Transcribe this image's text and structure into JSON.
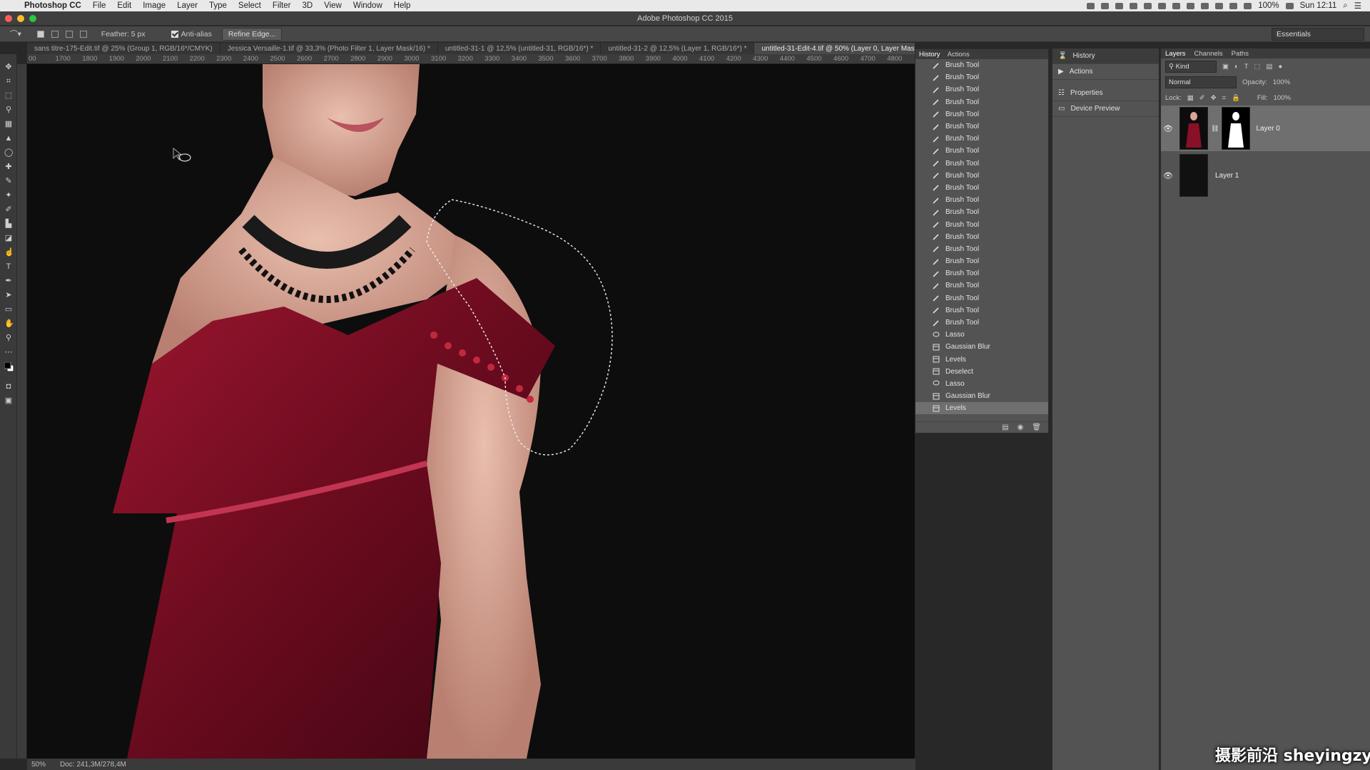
{
  "menubar": {
    "app_name": "Photoshop CC",
    "items": [
      "File",
      "Edit",
      "Image",
      "Layer",
      "Type",
      "Select",
      "Filter",
      "3D",
      "View",
      "Window",
      "Help"
    ],
    "battery": "100%",
    "clock": "Sun 12:11"
  },
  "window_title": "Adobe Photoshop CC 2015",
  "options_bar": {
    "feather_label": "Feather: 5 px",
    "antialias_label": "Anti-alias",
    "refine_edge_label": "Refine Edge...",
    "workspace": "Essentials"
  },
  "tabs": [
    "sans titre-175-Edit.tif @ 25% (Group 1, RGB/16*/CMYK)",
    "Jessica Versaille-1.tif @ 33,3% (Photo Filter 1, Layer Mask/16) *",
    "untitled-31-1 @ 12,5% (untitled-31, RGB/16*) *",
    "untitled-31-2 @ 12,5% (Layer 1, RGB/16*) *",
    "untitled-31-Edit-4.tif @ 50% (Layer 0, Layer Mask/16) *"
  ],
  "ruler_ticks": [
    "00",
    "1700",
    "1800",
    "1900",
    "2000",
    "2100",
    "2200",
    "2300",
    "2400",
    "2500",
    "2600",
    "2700",
    "2800",
    "2900",
    "3000",
    "3100",
    "3200",
    "3300",
    "3400",
    "3500",
    "3600",
    "3700",
    "3800",
    "3900",
    "4000",
    "4100",
    "4200",
    "4300",
    "4400",
    "4500",
    "4600",
    "4700",
    "4800"
  ],
  "history": {
    "tabs": [
      "History",
      "Actions"
    ],
    "items": [
      {
        "label": "Brush Tool",
        "icon": "brush-icon"
      },
      {
        "label": "Brush Tool",
        "icon": "brush-icon"
      },
      {
        "label": "Brush Tool",
        "icon": "brush-icon"
      },
      {
        "label": "Brush Tool",
        "icon": "brush-icon"
      },
      {
        "label": "Brush Tool",
        "icon": "brush-icon"
      },
      {
        "label": "Brush Tool",
        "icon": "brush-icon"
      },
      {
        "label": "Brush Tool",
        "icon": "brush-icon"
      },
      {
        "label": "Brush Tool",
        "icon": "brush-icon"
      },
      {
        "label": "Brush Tool",
        "icon": "brush-icon"
      },
      {
        "label": "Brush Tool",
        "icon": "brush-icon"
      },
      {
        "label": "Brush Tool",
        "icon": "brush-icon"
      },
      {
        "label": "Brush Tool",
        "icon": "brush-icon"
      },
      {
        "label": "Brush Tool",
        "icon": "brush-icon"
      },
      {
        "label": "Brush Tool",
        "icon": "brush-icon"
      },
      {
        "label": "Brush Tool",
        "icon": "brush-icon"
      },
      {
        "label": "Brush Tool",
        "icon": "brush-icon"
      },
      {
        "label": "Brush Tool",
        "icon": "brush-icon"
      },
      {
        "label": "Brush Tool",
        "icon": "brush-icon"
      },
      {
        "label": "Brush Tool",
        "icon": "brush-icon"
      },
      {
        "label": "Brush Tool",
        "icon": "brush-icon"
      },
      {
        "label": "Brush Tool",
        "icon": "brush-icon"
      },
      {
        "label": "Brush Tool",
        "icon": "brush-icon"
      },
      {
        "label": "Lasso",
        "icon": "lasso-icon"
      },
      {
        "label": "Gaussian Blur",
        "icon": "filter-icon"
      },
      {
        "label": "Levels",
        "icon": "filter-icon"
      },
      {
        "label": "Deselect",
        "icon": "filter-icon"
      },
      {
        "label": "Lasso",
        "icon": "lasso-icon"
      },
      {
        "label": "Gaussian Blur",
        "icon": "filter-icon"
      },
      {
        "label": "Levels",
        "icon": "filter-icon"
      }
    ]
  },
  "side_panel": {
    "items": [
      {
        "label": "History",
        "icon": "history-icon"
      },
      {
        "label": "Actions",
        "icon": "play-icon"
      },
      {
        "label": "Properties",
        "icon": "properties-icon"
      },
      {
        "label": "Device Preview",
        "icon": "device-icon"
      }
    ]
  },
  "layers_panel": {
    "tabs": [
      "Layers",
      "Channels",
      "Paths"
    ],
    "kind_label": "Kind",
    "blend_mode": "Normal",
    "opacity_label": "Opacity:",
    "opacity_value": "100%",
    "lock_label": "Lock:",
    "fill_label": "Fill:",
    "fill_value": "100%",
    "layers": [
      {
        "name": "Layer 0",
        "selected": true
      },
      {
        "name": "Layer 1",
        "selected": false
      }
    ]
  },
  "status_bar": {
    "zoom": "50%",
    "doc": "Doc: 241,3M/278,4M"
  },
  "watermark": "摄影前沿 sheyingzyz.com"
}
